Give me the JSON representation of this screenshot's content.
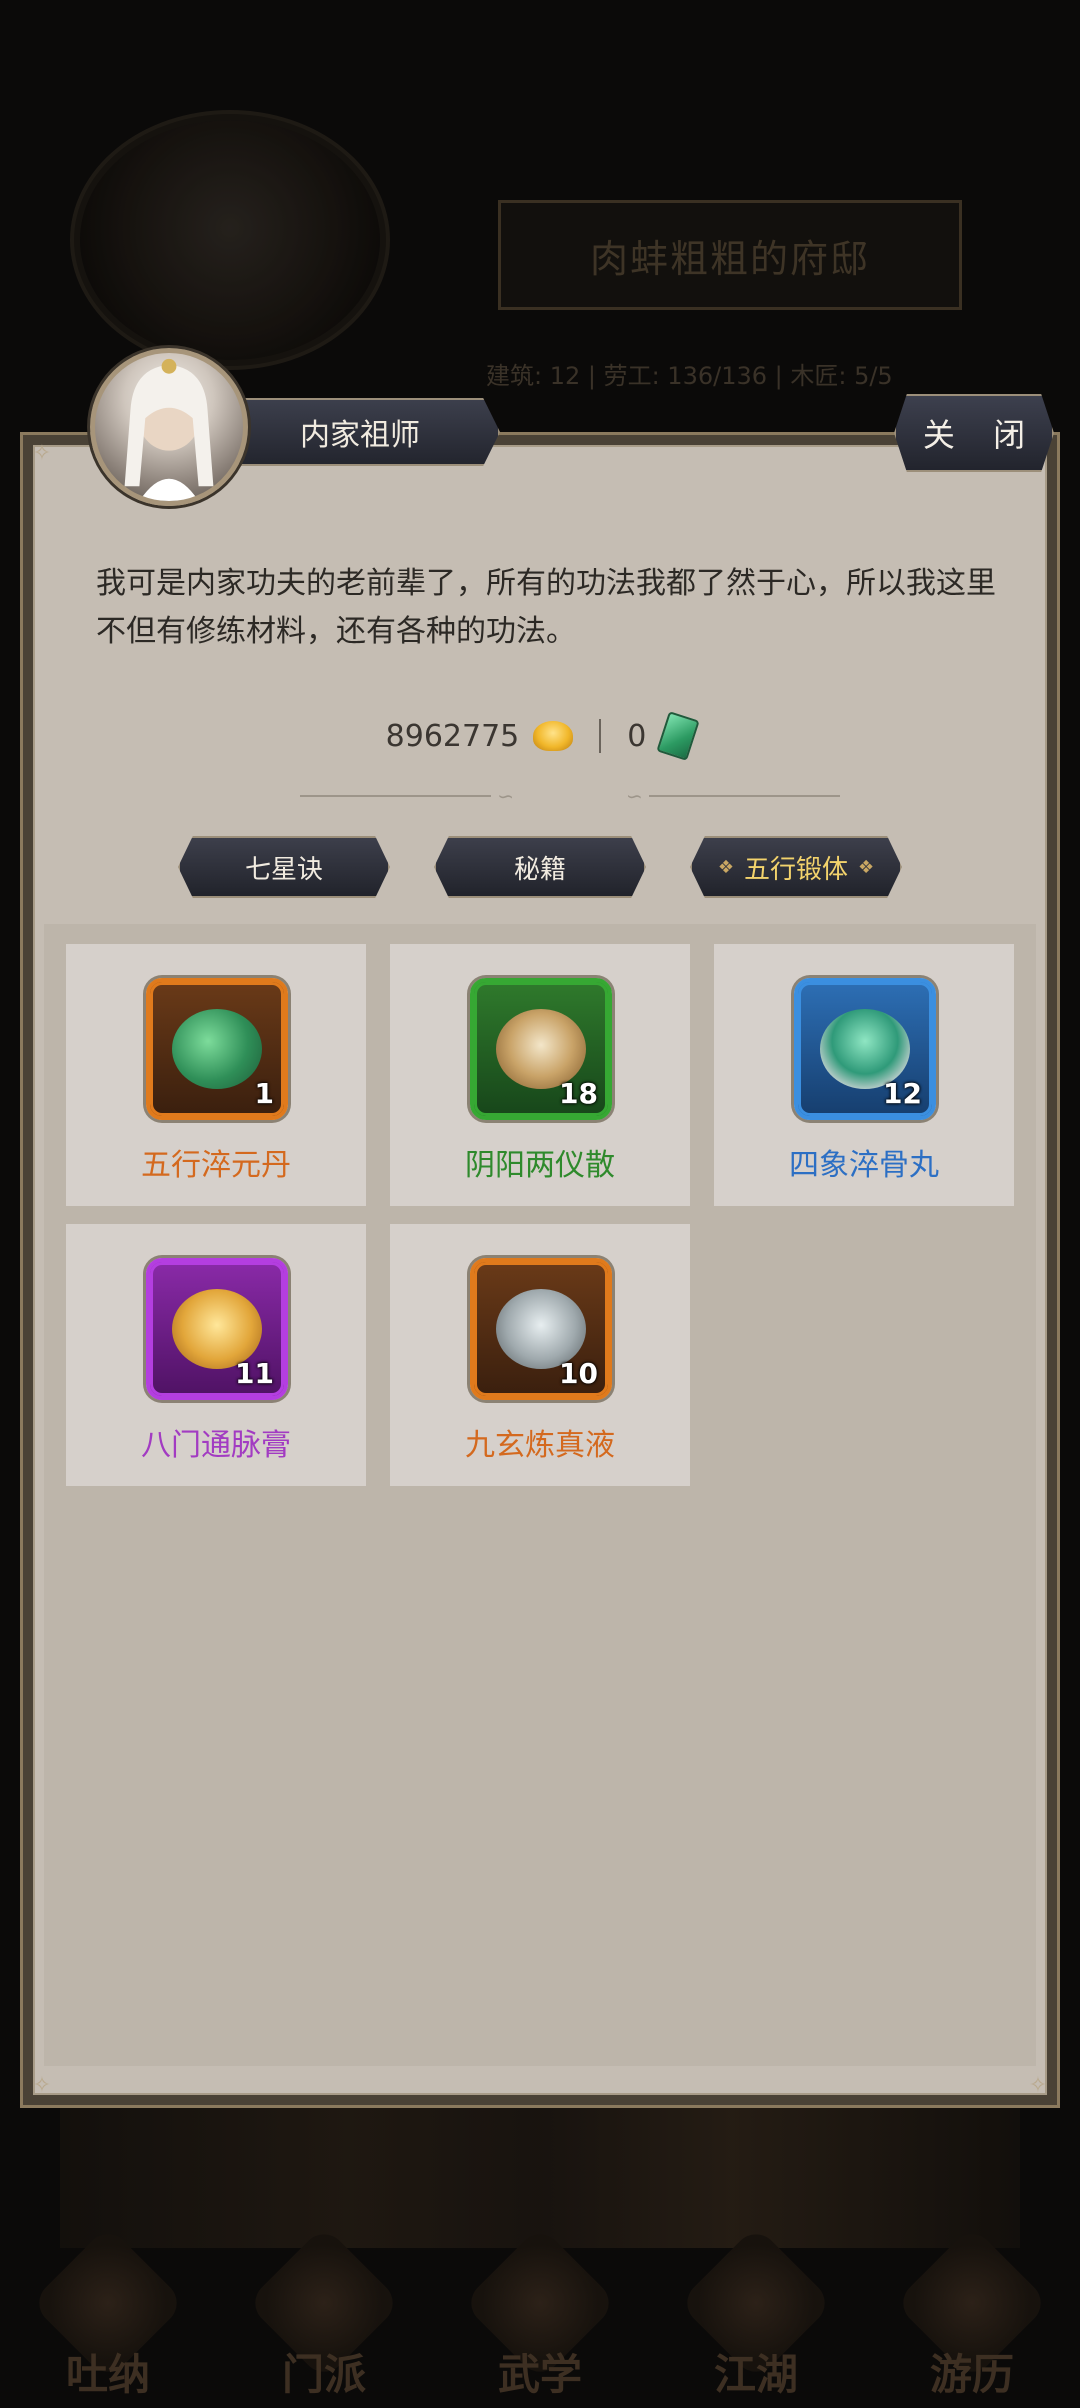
{
  "background": {
    "residence_title": "肉蚌粗粗的府邸",
    "stats_line": "建筑: 12  |  劳工: 136/136  |  木匠: 5/5",
    "nav": [
      {
        "label": "吐纳"
      },
      {
        "label": "门派"
      },
      {
        "label": "武学"
      },
      {
        "label": "江湖"
      },
      {
        "label": "游历"
      }
    ]
  },
  "dialog": {
    "npc_name": "内家祖师",
    "close_label": "关 闭",
    "description": "我可是内家功夫的老前辈了，所有的功法我都了然于心，所以我这里不但有修练材料，还有各种的功法。",
    "currency": {
      "gold": "8962775",
      "gold_icon": "gold-ingot-icon",
      "jade": "0",
      "jade_icon": "jade-token-icon"
    },
    "tabs": [
      {
        "label": "七星诀",
        "active": false
      },
      {
        "label": "秘籍",
        "active": false
      },
      {
        "label": "五行锻体",
        "active": true
      }
    ],
    "items": [
      {
        "name": "五行淬元丹",
        "count": "1",
        "rarity_color": "#d4691e",
        "frame": "#e07a1c",
        "icon": "green-elixir-jar-icon"
      },
      {
        "name": "阴阳两仪散",
        "count": "18",
        "rarity_color": "#2f8a2c",
        "frame": "#36a833",
        "icon": "yinyang-powder-icon"
      },
      {
        "name": "四象淬骨丸",
        "count": "12",
        "rarity_color": "#2c6fc4",
        "frame": "#3b8fe0",
        "icon": "jade-beast-book-icon"
      },
      {
        "name": "八门通脉膏",
        "count": "11",
        "rarity_color": "#a23bc2",
        "frame": "#b43ee0",
        "icon": "octagon-box-icon"
      },
      {
        "name": "九玄炼真液",
        "count": "10",
        "rarity_color": "#d4691e",
        "frame": "#e07a1c",
        "icon": "silver-urn-icon"
      }
    ]
  }
}
